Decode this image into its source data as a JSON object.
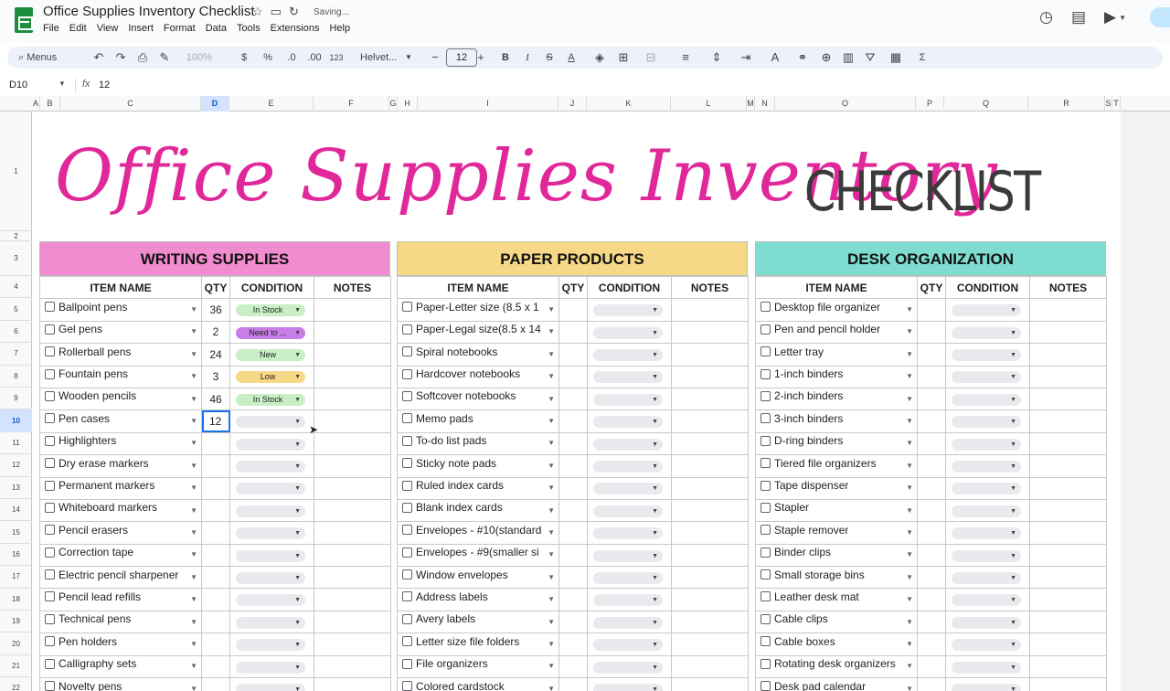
{
  "app": {
    "title": "Office Supplies Inventory Checklist",
    "saving_status": "Saving...",
    "menus": [
      "File",
      "Edit",
      "View",
      "Insert",
      "Format",
      "Data",
      "Tools",
      "Extensions",
      "Help"
    ]
  },
  "toolbar": {
    "menus_search": "Menus",
    "zoom": "100%",
    "currency": "$",
    "percent": "%",
    "dec_decrease": ".0",
    "dec_increase": ".00",
    "number_format": "123",
    "font": "Helvet...",
    "font_size": "12",
    "bold": "B",
    "italic": "I",
    "strike": "S",
    "text_color": "A",
    "sum": "Σ"
  },
  "formula_bar": {
    "cell_ref": "D10",
    "fx": "fx",
    "value": "12"
  },
  "columns": [
    "A",
    "B",
    "C",
    "D",
    "E",
    "F",
    "G",
    "H",
    "I",
    "J",
    "K",
    "L",
    "M",
    "N",
    "O",
    "P",
    "Q",
    "R",
    "S",
    "T"
  ],
  "rows": [
    "1",
    "2",
    "3",
    "4",
    "5",
    "6",
    "7",
    "8",
    "9",
    "10",
    "11",
    "12",
    "13",
    "14",
    "15",
    "16",
    "17",
    "18",
    "19",
    "20",
    "21",
    "22"
  ],
  "banner": {
    "script_title": "Office Supplies Inventory",
    "checklist": "CHECKLIST"
  },
  "colors": {
    "writing": "#f08ccf",
    "paper": "#f7d886",
    "desk": "#7fdcd1",
    "title_pink": "#e0289a",
    "in_stock": "#c9efc6",
    "need": "#c97de6",
    "new": "#c9efc6",
    "low": "#f7d886"
  },
  "table_headers": {
    "item": "ITEM NAME",
    "qty": "QTY",
    "condition": "CONDITION",
    "notes": "NOTES"
  },
  "sections": [
    {
      "title": "WRITING SUPPLIES",
      "items": [
        {
          "name": "Ballpoint pens",
          "qty": "36",
          "condition": "In Stock"
        },
        {
          "name": "Gel pens",
          "qty": "2",
          "condition": "Need to ..."
        },
        {
          "name": "Rollerball pens",
          "qty": "24",
          "condition": "New"
        },
        {
          "name": "Fountain pens",
          "qty": "3",
          "condition": "Low"
        },
        {
          "name": "Wooden pencils",
          "qty": "46",
          "condition": "In Stock"
        },
        {
          "name": "Pen cases",
          "qty": "12",
          "condition": ""
        },
        {
          "name": "Highlighters",
          "qty": "",
          "condition": ""
        },
        {
          "name": "Dry erase markers",
          "qty": "",
          "condition": ""
        },
        {
          "name": "Permanent markers",
          "qty": "",
          "condition": ""
        },
        {
          "name": "Whiteboard markers",
          "qty": "",
          "condition": ""
        },
        {
          "name": "Pencil erasers",
          "qty": "",
          "condition": ""
        },
        {
          "name": "Correction tape",
          "qty": "",
          "condition": ""
        },
        {
          "name": "Electric pencil sharpener",
          "qty": "",
          "condition": ""
        },
        {
          "name": "Pencil lead refills",
          "qty": "",
          "condition": ""
        },
        {
          "name": "Technical pens",
          "qty": "",
          "condition": ""
        },
        {
          "name": "Pen holders",
          "qty": "",
          "condition": ""
        },
        {
          "name": "Calligraphy sets",
          "qty": "",
          "condition": ""
        },
        {
          "name": "Novelty pens",
          "qty": "",
          "condition": ""
        }
      ]
    },
    {
      "title": "PAPER PRODUCTS",
      "items": [
        {
          "name": "Paper-Letter size (8.5 x 1",
          "qty": "",
          "condition": ""
        },
        {
          "name": "Paper-Legal size(8.5 x 14",
          "qty": "",
          "condition": ""
        },
        {
          "name": "Spiral notebooks",
          "qty": "",
          "condition": ""
        },
        {
          "name": "Hardcover notebooks",
          "qty": "",
          "condition": ""
        },
        {
          "name": "Softcover notebooks",
          "qty": "",
          "condition": ""
        },
        {
          "name": "Memo pads",
          "qty": "",
          "condition": ""
        },
        {
          "name": "To-do list pads",
          "qty": "",
          "condition": ""
        },
        {
          "name": "Sticky note pads",
          "qty": "",
          "condition": ""
        },
        {
          "name": "Ruled index cards",
          "qty": "",
          "condition": ""
        },
        {
          "name": "Blank index cards",
          "qty": "",
          "condition": ""
        },
        {
          "name": "Envelopes - #10(standard",
          "qty": "",
          "condition": ""
        },
        {
          "name": "Envelopes - #9(smaller si",
          "qty": "",
          "condition": ""
        },
        {
          "name": "Window envelopes",
          "qty": "",
          "condition": ""
        },
        {
          "name": "Address labels",
          "qty": "",
          "condition": ""
        },
        {
          "name": "Avery labels",
          "qty": "",
          "condition": ""
        },
        {
          "name": "Letter size file folders",
          "qty": "",
          "condition": ""
        },
        {
          "name": "File organizers",
          "qty": "",
          "condition": ""
        },
        {
          "name": "Colored cardstock",
          "qty": "",
          "condition": ""
        }
      ]
    },
    {
      "title": "DESK ORGANIZATION",
      "items": [
        {
          "name": "Desktop file organizer",
          "qty": "",
          "condition": ""
        },
        {
          "name": "Pen and pencil holder",
          "qty": "",
          "condition": ""
        },
        {
          "name": "Letter tray",
          "qty": "",
          "condition": ""
        },
        {
          "name": "1-inch binders",
          "qty": "",
          "condition": ""
        },
        {
          "name": "2-inch binders",
          "qty": "",
          "condition": ""
        },
        {
          "name": "3-inch binders",
          "qty": "",
          "condition": ""
        },
        {
          "name": "D-ring binders",
          "qty": "",
          "condition": ""
        },
        {
          "name": "Tiered file organizers",
          "qty": "",
          "condition": ""
        },
        {
          "name": "Tape dispenser",
          "qty": "",
          "condition": ""
        },
        {
          "name": "Stapler",
          "qty": "",
          "condition": ""
        },
        {
          "name": "Staple remover",
          "qty": "",
          "condition": ""
        },
        {
          "name": "Binder clips",
          "qty": "",
          "condition": ""
        },
        {
          "name": "Small storage bins",
          "qty": "",
          "condition": ""
        },
        {
          "name": "Leather desk mat",
          "qty": "",
          "condition": ""
        },
        {
          "name": "Cable clips",
          "qty": "",
          "condition": ""
        },
        {
          "name": "Cable boxes",
          "qty": "",
          "condition": ""
        },
        {
          "name": "Rotating desk organizers",
          "qty": "",
          "condition": ""
        },
        {
          "name": "Desk pad calendar",
          "qty": "",
          "condition": ""
        }
      ]
    }
  ]
}
